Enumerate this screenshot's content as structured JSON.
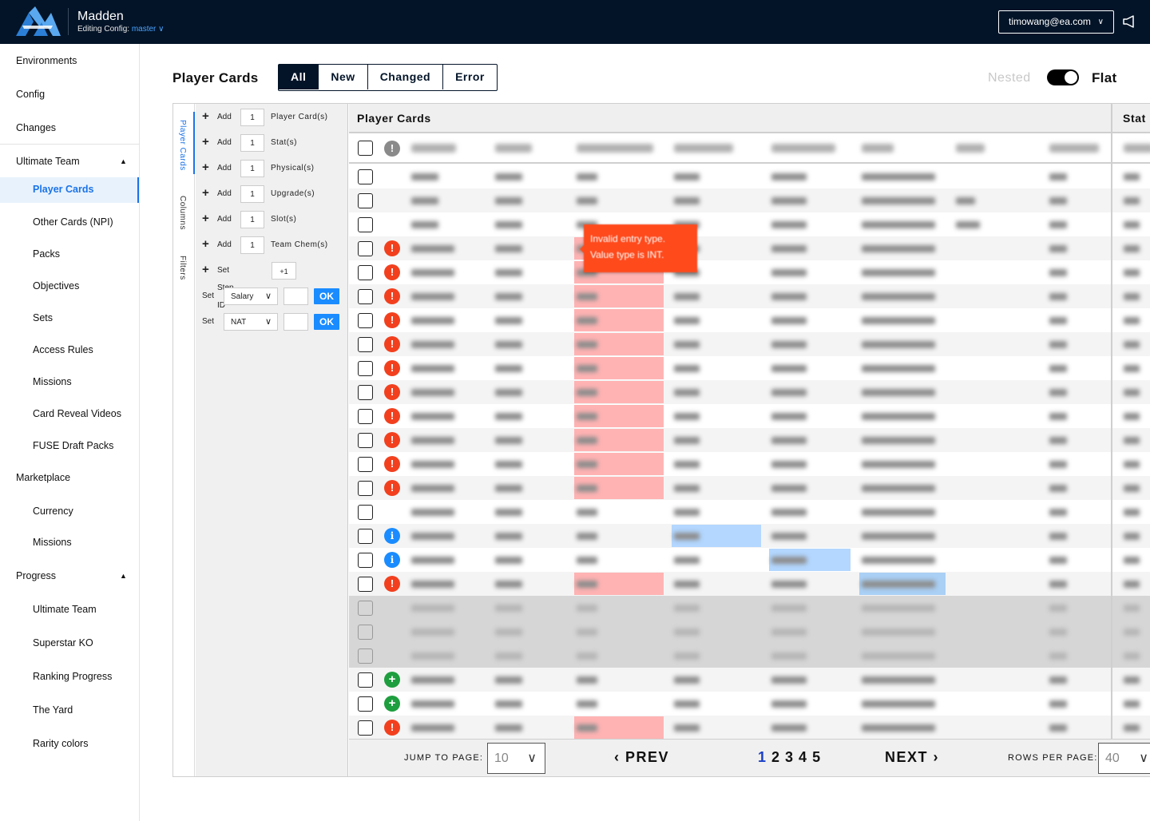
{
  "app": {
    "name": "Madden",
    "editing_prefix": "Editing Config:",
    "branch": "master",
    "user": "timowang@ea.com"
  },
  "sidebar": {
    "items": [
      {
        "label": "Environments",
        "indent": 0
      },
      {
        "label": "Config",
        "indent": 0
      },
      {
        "label": "Changes",
        "indent": 0
      },
      {
        "label": "Ultimate Team",
        "indent": 0,
        "expanded": true
      },
      {
        "label": "Player Cards",
        "indent": 1,
        "active": true
      },
      {
        "label": "Other Cards (NPI)",
        "indent": 1
      },
      {
        "label": "Packs",
        "indent": 1
      },
      {
        "label": "Objectives",
        "indent": 1
      },
      {
        "label": "Sets",
        "indent": 1
      },
      {
        "label": "Access Rules",
        "indent": 1
      },
      {
        "label": "Missions",
        "indent": 1
      },
      {
        "label": "Card Reveal Videos",
        "indent": 1
      },
      {
        "label": "FUSE Draft Packs",
        "indent": 1
      },
      {
        "label": "Marketplace",
        "indent": 0
      },
      {
        "label": "Currency",
        "indent": 1
      },
      {
        "label": "Missions",
        "indent": 1
      },
      {
        "label": "Progress",
        "indent": 0,
        "expanded": true
      },
      {
        "label": "Ultimate Team",
        "indent": 1
      },
      {
        "label": "Superstar KO",
        "indent": 1
      },
      {
        "label": "Ranking Progress",
        "indent": 1
      },
      {
        "label": "The Yard",
        "indent": 1
      },
      {
        "label": "Rarity colors",
        "indent": 1
      }
    ]
  },
  "header": {
    "title": "Player Cards",
    "filters": [
      "All",
      "New",
      "Changed",
      "Error"
    ],
    "active_filter": "All",
    "view_nested": "Nested",
    "view_flat": "Flat",
    "view_mode": "Flat"
  },
  "vertical_tabs": [
    "Player Cards",
    "Columns",
    "Filters"
  ],
  "tools": {
    "add_rows": [
      {
        "action": "Add",
        "count": "1",
        "label": "Player Card(s)"
      },
      {
        "action": "Add",
        "count": "1",
        "label": "Stat(s)"
      },
      {
        "action": "Add",
        "count": "1",
        "label": "Physical(s)"
      },
      {
        "action": "Add",
        "count": "1",
        "label": "Upgrade(s)"
      },
      {
        "action": "Add",
        "count": "1",
        "label": "Slot(s)"
      },
      {
        "action": "Add",
        "count": "1",
        "label": "Team Chem(s)"
      }
    ],
    "step": {
      "label": "Set Step ID",
      "value": "+1"
    },
    "set_rows": [
      {
        "action": "Set",
        "field": "Salary",
        "value": "",
        "ok": "OK"
      },
      {
        "action": "Set",
        "field": "NAT",
        "value": "",
        "ok": "OK"
      }
    ]
  },
  "grid": {
    "title": "Player Cards",
    "stat_title": "Stat",
    "tooltip": {
      "line1": "Invalid entry type.",
      "line2": "Value type is INT."
    },
    "rows": [
      {
        "status": "none",
        "state": "normal",
        "err": false
      },
      {
        "status": "none",
        "state": "normal",
        "err": false
      },
      {
        "status": "none",
        "state": "normal",
        "err": false
      },
      {
        "status": "error",
        "state": "normal",
        "err": true
      },
      {
        "status": "error",
        "state": "normal",
        "err": true
      },
      {
        "status": "error",
        "state": "normal",
        "err": true
      },
      {
        "status": "error",
        "state": "normal",
        "err": true
      },
      {
        "status": "error",
        "state": "normal",
        "err": true
      },
      {
        "status": "error",
        "state": "normal",
        "err": true
      },
      {
        "status": "error",
        "state": "normal",
        "err": true
      },
      {
        "status": "error",
        "state": "normal",
        "err": true
      },
      {
        "status": "error",
        "state": "normal",
        "err": true
      },
      {
        "status": "error",
        "state": "normal",
        "err": true
      },
      {
        "status": "error",
        "state": "normal",
        "err": true
      },
      {
        "status": "none",
        "state": "normal",
        "err": false
      },
      {
        "status": "info",
        "state": "normal",
        "err": false,
        "changed": "first"
      },
      {
        "status": "info",
        "state": "normal",
        "err": false,
        "changed": "last"
      },
      {
        "status": "error",
        "state": "normal",
        "err": true,
        "changed": "team"
      },
      {
        "status": "none",
        "state": "disabled",
        "err": false
      },
      {
        "status": "none",
        "state": "disabled",
        "err": false
      },
      {
        "status": "none",
        "state": "disabled",
        "err": false
      },
      {
        "status": "added",
        "state": "normal",
        "err": false
      },
      {
        "status": "added",
        "state": "normal",
        "err": false
      },
      {
        "status": "error",
        "state": "normal",
        "err": true
      }
    ]
  },
  "pagination": {
    "jump_label": "JUMP TO PAGE:",
    "jump_value": "10",
    "prev": "PREV",
    "next": "NEXT",
    "pages": [
      "1",
      "2",
      "3",
      "4",
      "5"
    ],
    "current": "1",
    "rows_label": "ROWS PER PAGE:",
    "rows_value": "40"
  },
  "colors": {
    "navbar": "#031428",
    "accent": "#1a73e8",
    "error": "#f2401e",
    "info": "#1a8cff",
    "added": "#1e9e3e"
  }
}
